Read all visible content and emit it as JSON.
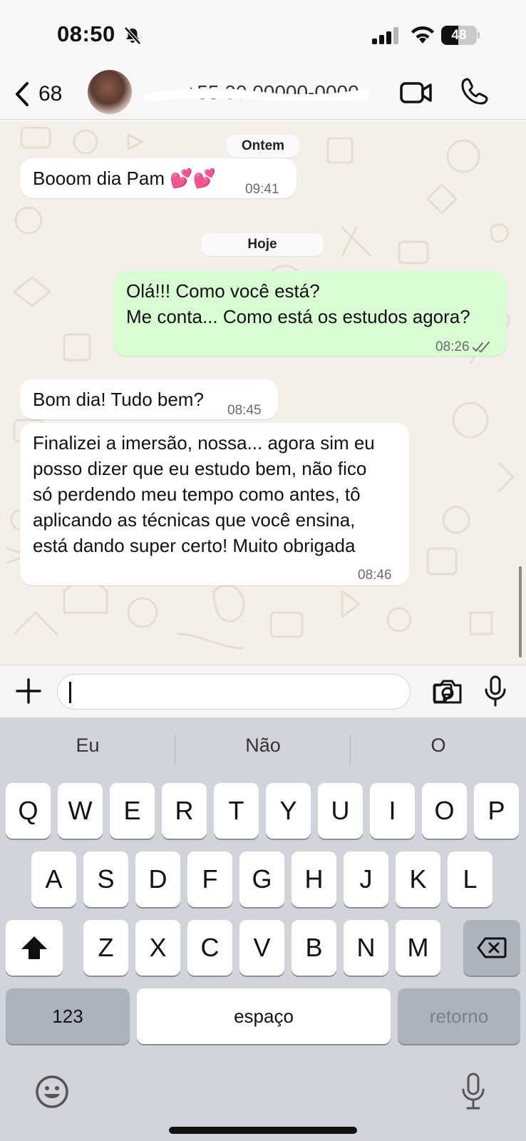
{
  "status_bar": {
    "time": "08:50",
    "battery": "48",
    "battery_level_percent": 48
  },
  "header": {
    "back_count": "68",
    "contact_name": "+55 00 00000-0000"
  },
  "chat": {
    "date_separators": [
      "Ontem",
      "Hoje"
    ],
    "messages": [
      {
        "direction": "incoming",
        "text": "Booom dia Pam 💕💕",
        "time": "09:41"
      },
      {
        "direction": "outgoing",
        "text": "Olá!!! Como você está?\nMe conta... Como está os estudos agora?",
        "time": "08:26",
        "status": "read"
      },
      {
        "direction": "incoming",
        "text": "Bom dia! Tudo bem?",
        "time": "08:45"
      },
      {
        "direction": "incoming",
        "text": "Finalizei a imersão, nossa... agora sim eu\nposso dizer que eu estudo bem, não fico\nsó perdendo meu tempo como antes, tô\naplicando as técnicas que você ensina,\nestá dando super certo! Muito obrigada",
        "time": "08:46"
      }
    ]
  },
  "input": {
    "value": ""
  },
  "keyboard": {
    "suggestions": [
      "Eu",
      "Não",
      "O"
    ],
    "rows": [
      [
        "Q",
        "W",
        "E",
        "R",
        "T",
        "Y",
        "U",
        "I",
        "O",
        "P"
      ],
      [
        "A",
        "S",
        "D",
        "F",
        "G",
        "H",
        "J",
        "K",
        "L"
      ],
      [
        "Z",
        "X",
        "C",
        "V",
        "B",
        "N",
        "M"
      ]
    ],
    "numbers_label": "123",
    "space_label": "espaço",
    "return_label": "retorno"
  },
  "colors": {
    "outgoing_bubble": "#d9fdd3",
    "incoming_bubble": "#ffffff",
    "chat_background": "#f4efe8",
    "keyboard_background": "#d1d4da",
    "read_ticks": "#53bdeb"
  },
  "icons": [
    "bell-slash-icon",
    "signal-icon",
    "wifi-icon",
    "battery-icon",
    "chevron-left-icon",
    "video-camera-icon",
    "phone-icon",
    "plus-icon",
    "sticker-icon",
    "camera-icon",
    "microphone-icon",
    "shift-icon",
    "backspace-icon",
    "emoji-icon",
    "dictation-microphone-icon"
  ]
}
